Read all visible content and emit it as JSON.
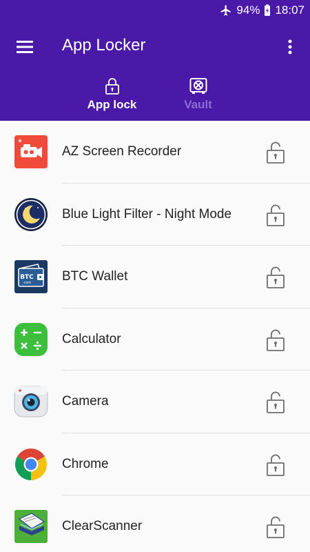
{
  "status_bar": {
    "battery": "94%",
    "time": "18:07"
  },
  "app_bar": {
    "title": "App Locker"
  },
  "tabs": [
    {
      "label": "App lock",
      "icon": "padlock-icon",
      "active": true
    },
    {
      "label": "Vault",
      "icon": "vault-icon",
      "active": false
    }
  ],
  "apps": [
    {
      "name": "AZ Screen Recorder",
      "icon": "az-screen-recorder-icon"
    },
    {
      "name": "Blue Light Filter - Night Mode",
      "icon": "blue-light-filter-icon"
    },
    {
      "name": "BTC Wallet",
      "icon": "btc-wallet-icon"
    },
    {
      "name": "Calculator",
      "icon": "calculator-icon"
    },
    {
      "name": "Camera",
      "icon": "camera-icon"
    },
    {
      "name": "Chrome",
      "icon": "chrome-icon"
    },
    {
      "name": "ClearScanner",
      "icon": "clearscanner-icon"
    }
  ],
  "colors": {
    "app_bar": "#4a19a8",
    "tab_inactive": "#8e6bd6",
    "divider": "#dedede"
  }
}
